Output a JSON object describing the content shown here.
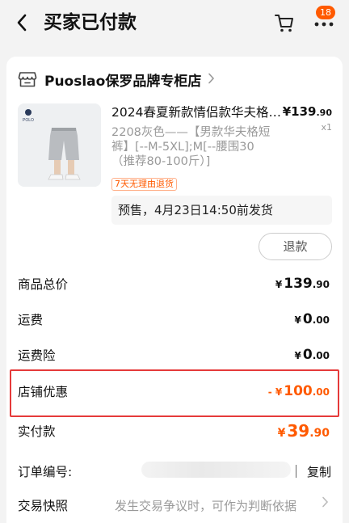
{
  "header": {
    "title": "买家已付款",
    "badge_count": "18",
    "back_icon": "chevron-left-icon",
    "cart_icon": "cart-icon",
    "more_icon": "more-dots-icon"
  },
  "store": {
    "name": "Puoslao保罗品牌专柜店",
    "icon": "store-icon"
  },
  "product": {
    "title": "2024春夏新款情侣款华夫格短裤",
    "price_int": "¥139",
    "price_dec": ".90",
    "quantity": "x1",
    "sku": "2208灰色——【男款华夫格短裤】[--M-5XL];M[--腰围30（推荐80-100斤）]",
    "tag": "7天无理由退货",
    "presale": "预售，4月23日14:50前发货",
    "refund_button": "退款"
  },
  "summary": {
    "goods_total_label": "商品总价",
    "goods_total_cur": "¥",
    "goods_total_int": "139",
    "goods_total_dec": ".90",
    "shipping_label": "运费",
    "shipping_cur": "¥",
    "shipping_int": "0",
    "shipping_dec": ".00",
    "shipping_ins_label": "运费险",
    "shipping_ins_cur": "¥",
    "shipping_ins_int": "0",
    "shipping_ins_dec": ".00",
    "discount_label": "店铺优惠",
    "discount_cur": "- ¥",
    "discount_int": "100",
    "discount_dec": ".00",
    "paid_label": "实付款",
    "paid_cur": "¥",
    "paid_int": "39",
    "paid_dec": ".90"
  },
  "order": {
    "number_label": "订单编号:",
    "copy_button": "复制",
    "snapshot_label": "交易快照",
    "snapshot_hint": "发生交易争议时，可作为判断依据"
  },
  "colors": {
    "accent": "#ff5a00",
    "highlight_border": "#e53a3a"
  }
}
